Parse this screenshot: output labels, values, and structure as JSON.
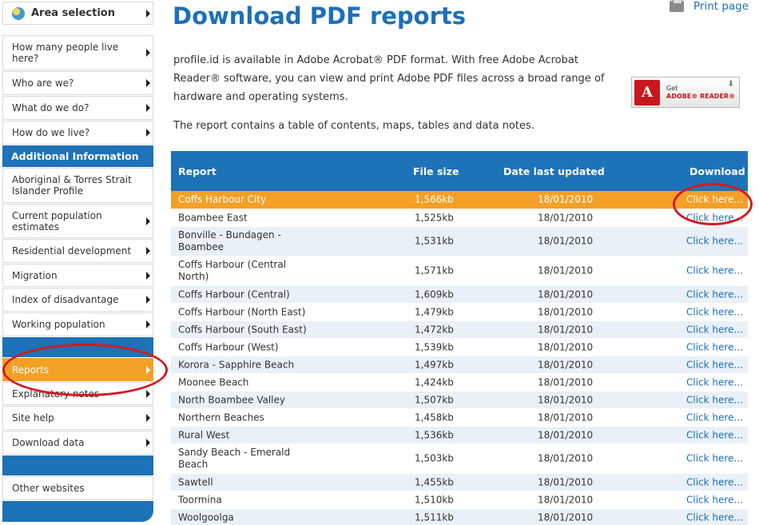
{
  "sidebar": {
    "area_selection": "Area selection",
    "group1": [
      "How many people live here?",
      "Who are we?",
      "What do we do?",
      "How do we live?"
    ],
    "additional_header": "Additional Information",
    "group2": [
      "Aboriginal & Torres Strait Islander Profile",
      "Current population estimates",
      "Residential development",
      "Migration",
      "Index of disadvantage",
      "Working population"
    ],
    "group3": [
      "Reports",
      "Explanatory notes",
      "Site help",
      "Download data"
    ],
    "other_websites": "Other websites"
  },
  "header": {
    "title": "Download PDF reports",
    "print_label": "Print page"
  },
  "intro": {
    "p1": "profile.id is available in Adobe Acrobat® PDF format. With free Adobe Acrobat Reader® software, you can view and print Adobe PDF files across a broad range of hardware and operating systems.",
    "p2": "The report contains a table of contents, maps, tables and data notes."
  },
  "adobe_badge": {
    "line1": "Get",
    "line2": "ADOBE® READER®"
  },
  "table": {
    "headers": [
      "Report",
      "File size",
      "Date last updated",
      "Download"
    ],
    "rows": [
      {
        "name": "Coffs Harbour City",
        "size": "1,566kb",
        "date": "18/01/2010",
        "link": "Click here..."
      },
      {
        "name": "Boambee East",
        "size": "1,525kb",
        "date": "18/01/2010",
        "link": "Click here..."
      },
      {
        "name": "Bonville - Bundagen - Boambee",
        "size": "1,531kb",
        "date": "18/01/2010",
        "link": "Click here..."
      },
      {
        "name": "Coffs Harbour (Central North)",
        "size": "1,571kb",
        "date": "18/01/2010",
        "link": "Click here..."
      },
      {
        "name": "Coffs Harbour (Central)",
        "size": "1,609kb",
        "date": "18/01/2010",
        "link": "Click here..."
      },
      {
        "name": "Coffs Harbour (North East)",
        "size": "1,479kb",
        "date": "18/01/2010",
        "link": "Click here..."
      },
      {
        "name": "Coffs Harbour (South East)",
        "size": "1,472kb",
        "date": "18/01/2010",
        "link": "Click here..."
      },
      {
        "name": "Coffs Harbour (West)",
        "size": "1,539kb",
        "date": "18/01/2010",
        "link": "Click here..."
      },
      {
        "name": "Korora - Sapphire Beach",
        "size": "1,497kb",
        "date": "18/01/2010",
        "link": "Click here..."
      },
      {
        "name": "Moonee Beach",
        "size": "1,424kb",
        "date": "18/01/2010",
        "link": "Click here..."
      },
      {
        "name": "North Boambee Valley",
        "size": "1,507kb",
        "date": "18/01/2010",
        "link": "Click here..."
      },
      {
        "name": "Northern Beaches",
        "size": "1,458kb",
        "date": "18/01/2010",
        "link": "Click here..."
      },
      {
        "name": "Rural West",
        "size": "1,536kb",
        "date": "18/01/2010",
        "link": "Click here..."
      },
      {
        "name": "Sandy Beach - Emerald Beach",
        "size": "1,503kb",
        "date": "18/01/2010",
        "link": "Click here..."
      },
      {
        "name": "Sawtell",
        "size": "1,455kb",
        "date": "18/01/2010",
        "link": "Click here..."
      },
      {
        "name": "Toormina",
        "size": "1,510kb",
        "date": "18/01/2010",
        "link": "Click here..."
      },
      {
        "name": "Woolgoolga",
        "size": "1,511kb",
        "date": "18/01/2010",
        "link": "Click here..."
      }
    ]
  },
  "colors": {
    "brand_blue": "#1d72b8",
    "highlight_orange": "#f4a027",
    "annotation_red": "#d11b22"
  }
}
